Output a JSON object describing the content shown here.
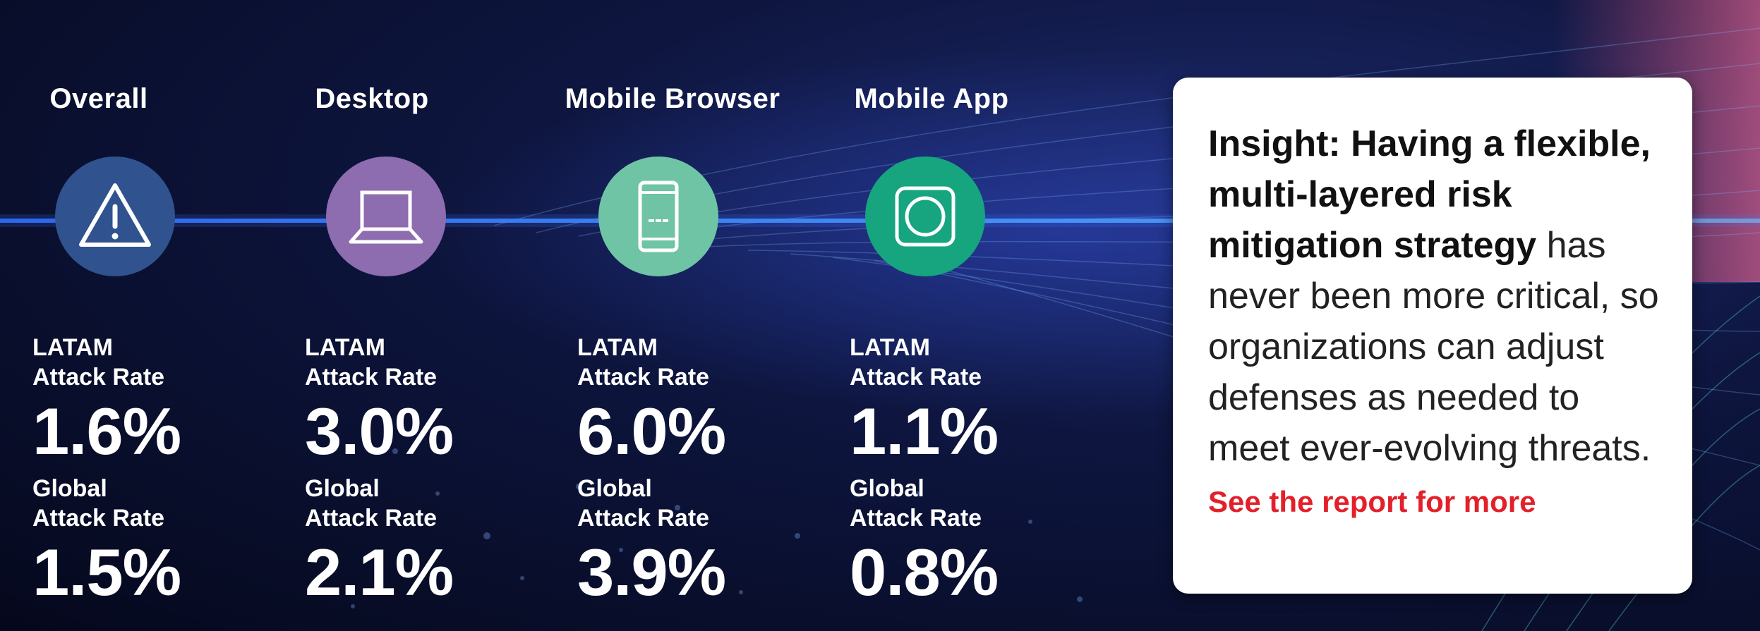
{
  "colors": {
    "overall": "#30528f",
    "desktop": "#8e6cb0",
    "mobile_browser": "#6ec4a4",
    "mobile_app": "#16a57e",
    "accent_link": "#e3202a"
  },
  "columns": [
    {
      "title": "Overall",
      "icon": "warning-triangle-icon",
      "latam_label_line1": "LATAM",
      "latam_label_line2": "Attack Rate",
      "latam_value": "1.6%",
      "global_label_line1": "Global",
      "global_label_line2": "Attack Rate",
      "global_value": "1.5%"
    },
    {
      "title": "Desktop",
      "icon": "laptop-icon",
      "latam_label_line1": "LATAM",
      "latam_label_line2": "Attack Rate",
      "latam_value": "3.0%",
      "global_label_line1": "Global",
      "global_label_line2": "Attack Rate",
      "global_value": "2.1%"
    },
    {
      "title": "Mobile Browser",
      "icon": "smartphone-icon",
      "latam_label_line1": "LATAM",
      "latam_label_line2": "Attack Rate",
      "latam_value": "6.0%",
      "global_label_line1": "Global",
      "global_label_line2": "Attack Rate",
      "global_value": "3.9%"
    },
    {
      "title": "Mobile App",
      "icon": "app-square-icon",
      "latam_label_line1": "LATAM",
      "latam_label_line2": "Attack Rate",
      "latam_value": "1.1%",
      "global_label_line1": "Global",
      "global_label_line2": "Attack Rate",
      "global_value": "0.8%"
    }
  ],
  "insight": {
    "bold": "Insight: Having a flexible, multi-layered risk mitigation strategy",
    "text": " has never been more critical, so organizations can adjust defenses as needed to meet ever-evolving threats.",
    "link": "See the report for more"
  }
}
